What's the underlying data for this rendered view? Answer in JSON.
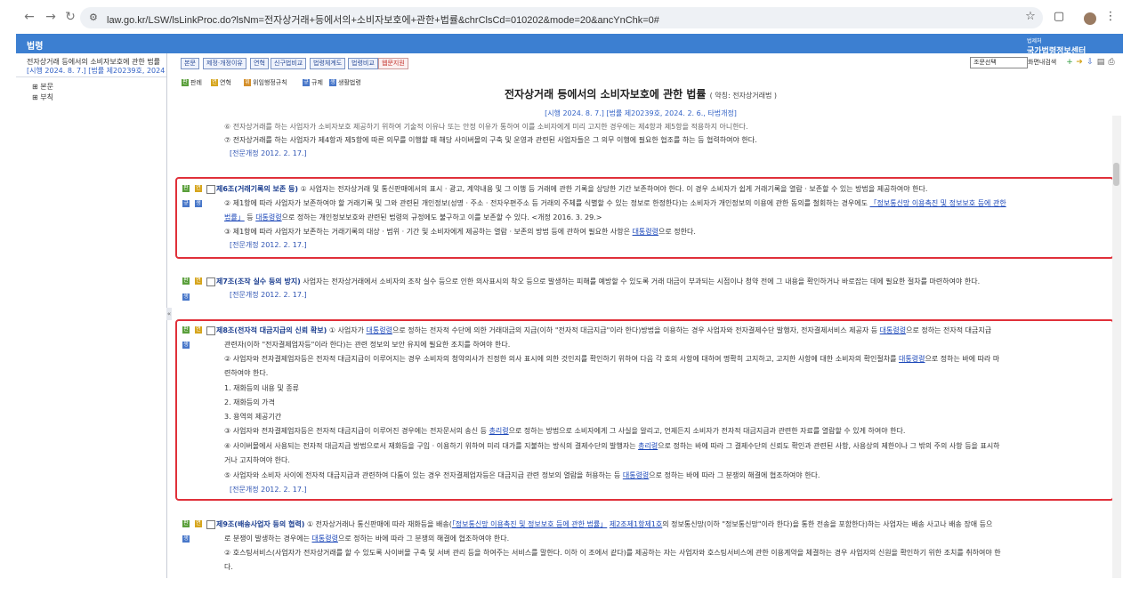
{
  "browser": {
    "url": "law.go.kr/LSW/lsLinkProc.do?lsNm=전자상거래+등에서의+소비자보호에+관한+법률&chrClsCd=010202&mode=20&ancYnChk=0#"
  },
  "header": {
    "title": "법령",
    "logo_small": "법제처",
    "logo": "국가법령정보센터"
  },
  "left_pane": {
    "law_title": "전자상거래 등에서의 소비자보호에 관한 법률",
    "law_date": "[시행 2024. 8. 7.] [법률 제20239호, 2024. 2, 6., 타법개정]",
    "tree": [
      "본문",
      "부칙"
    ]
  },
  "toolbar": {
    "buttons": [
      "본문",
      "제정·개정이유",
      "연혁",
      "신구법비교",
      "법령체계도",
      "법령비교",
      "웹문지원"
    ],
    "select_value": "조문선택",
    "search_nav": "화면내검색"
  },
  "legend": [
    "판례",
    "연혁",
    "위임행정규칙",
    "규제",
    "생활법령"
  ],
  "document": {
    "title": "전자상거래 등에서의 소비자보호에 관한 법률",
    "short_title": "( 약칭: 전자상거래법 )",
    "date": "[시행 2024. 8. 7.] [법률 제20239호, 2024. 2. 6., 타법개정]",
    "top_lines": [
      "⑥ 전자상거래를 하는 사업자가 소비자보호 제공하기 위하여 기술적 이유나 또는 안정 이유가 통하여 이를 소비자에게 미리 고지한 경우에는 제4항과 제5항을 적용하지 아니한다.",
      "⑦ 전자상거래를 하는 사업자가 제4항과 제5항에 따른 의무를 이행할 때 해당 사이버몰의 구축 및 운영과 관련된 사업자들은 그 의무 이행에 필요한 협조를 하는 등 협력하여야 한다.",
      "[전문개정 2012. 2. 17.]"
    ],
    "art6": {
      "heading": "제6조(거래기록의 보존 등)",
      "line1": "① 사업자는 전자상거래 및 통신판매에서의 표시 · 광고, 계약내용 및 그 이행 등 거래에 관한 기록을 상당한 기간 보존하여야 한다. 이 경우 소비자가 쉽게 거래기록을 열람 · 보존할 수 있는 방법을 제공하여야 한다.",
      "line2a": "② 제1항에 따라 사업자가 보존하여야 할 거래기록 및 그와 관련된 개인정보(성명 · 주소 · 전자우편주소 등 거래의 주체를 식별할 수 있는 정보로 한정한다)는 소비자가 개인정보의 이용에 관한 동의를 철회하는 경우에도 ",
      "line2link": "「정보통신망 이용촉진 및 정보보호 등에 관한",
      "line2b_link": "법률」",
      "line2b": " 등 ",
      "line2b_link2": "대통령령",
      "line2c": "으로 정하는 개인정보보호와 관련된 법령의 규정에도 불구하고 이를 보존할 수 있다. <개정 2016. 3. 29.>",
      "line3a": "③ 제1항에 따라 사업자가 보존하는 거래기록의 대상 · 범위 · 기간 및 소비자에게 제공하는 열람 · 보존의 방법 등에 관하여 필요한 사항은 ",
      "line3link": "대통령령",
      "line3b": "으로 정한다.",
      "amend": "[전문개정 2012. 2. 17.]"
    },
    "art7": {
      "heading": "제7조(조작 실수 등의 방지)",
      "text": " 사업자는 전자상거래에서 소비자의 조작 실수 등으로 인한 의사표시의 착오 등으로 발생하는 피해를 예방할 수 있도록 거래 대금이 부과되는 시점이나 청약 전에 그 내용을 확인하거나 바로잡는 데에 필요한 절차를 마련하여야 한다.",
      "amend": "[전문개정 2012. 2. 17.]"
    },
    "art8": {
      "heading": "제8조(전자적 대금지급의 신뢰 확보)",
      "line1a": " ① 사업자가 ",
      "line1link": "대통령령",
      "line1b": "으로 정하는 전자적 수단에 의한 거래대금의 지급(이하 \"전자적 대금지급\"이라 한다)방법을 이용하는 경우 사업자와 전자결제수단 발행자, 전자결제서비스 제공자 등 ",
      "line1link2": "대통령령",
      "line1c": "으로 정하는 전자적 대금지급",
      "line2": "관련자(이하 \"전자결제업자등\"이라 한다)는 관련 정보의 보안 유지에 필요한 조치를 하여야 한다.",
      "line3a": "② 사업자와 전자결제업자등은 전자적 대금지급이 이루어지는 경우 소비자의 청약의사가 진정한 의사 표시에 의한 것인지를 확인하기 위하여 다음 각 호의 사항에 대하여 명확히 고지하고, 고지한 사항에 대한 소비자의 확인절차를 ",
      "line3link": "대통령령",
      "line3b": "으로 정하는 바에 따라 마",
      "line4": "련하여야 한다.",
      "items": [
        "1. 재화등의 내용 및 종류",
        "2. 재화등의 가격",
        "3. 용역의 제공기간"
      ],
      "line5a": "③ 사업자와 전자결제업자등은 전자적 대금지급이 이루어진 경우에는 전자문서의 송신 등 ",
      "line5link": "총리령",
      "line5b": "으로 정하는 방법으로 소비자에게 그 사실을 알리고, 언제든지 소비자가 전자적 대금지급과 관련한 자료를 열람할 수 있게 하여야 한다.",
      "line6a": "④ 사이버몰에서 사용되는 전자적 대금지급 방법으로서 재화등을 구입 · 이용하기 위하여 미리 대가를 지불하는 방식의 결제수단의 발행자는 ",
      "line6link": "총리령",
      "line6b": "으로 정하는 바에 따라 그 결제수단의 신뢰도 확인과 관련된 사항, 사용상의 제한이나 그 밖의 주의 사항 등을 표시하",
      "line7": "거나 고지하여야 한다.",
      "line8a": "⑤ 사업자와 소비자 사이에 전자적 대금지급과 관련하여 다툼이 있는 경우 전자결제업자등은 대금지급 관련 정보의 열람을 허용하는 등 ",
      "line8link": "대통령령",
      "line8b": "으로 정하는 바에 따라 그 분쟁의 해결에 협조하여야 한다.",
      "amend": "[전문개정 2012. 2. 17.]"
    },
    "art9": {
      "heading": "제9조(배송사업자 등의 협력)",
      "line1a": " ① 전자상거래나 통신판매에 따라 재화등을 배송(",
      "line1link": "「정보통신망 이용촉진 및 정보보호 등에 관한 법률」",
      "line1b": " ",
      "line1link2": "제2조제1항제1호",
      "line1c": "의 정보통신망(이하 \"정보통신망\"이라 한다)을 통한 전송을 포함한다)하는 사업자는 배송 사고나 배송 장애 등으",
      "line2a": "로 분쟁이 발생하는 경우에는 ",
      "line2link": "대통령령",
      "line2b": "으로 정하는 바에 따라 그 분쟁의 해결에 협조하여야 한다.",
      "line3": "② 호스팅서비스(사업자가 전자상거래를 할 수 있도록 사이버몰 구축 및 서버 관리 등을 하여주는 서비스를 말한다. 이하 이 조에서 같다)를 제공하는 자는 사업자와 호스팅서비스에 관한 이용계약을 체결하는 경우 사업자의 신원을 확인하기 위한 조치를 취하여야 한",
      "line4": "다."
    }
  }
}
